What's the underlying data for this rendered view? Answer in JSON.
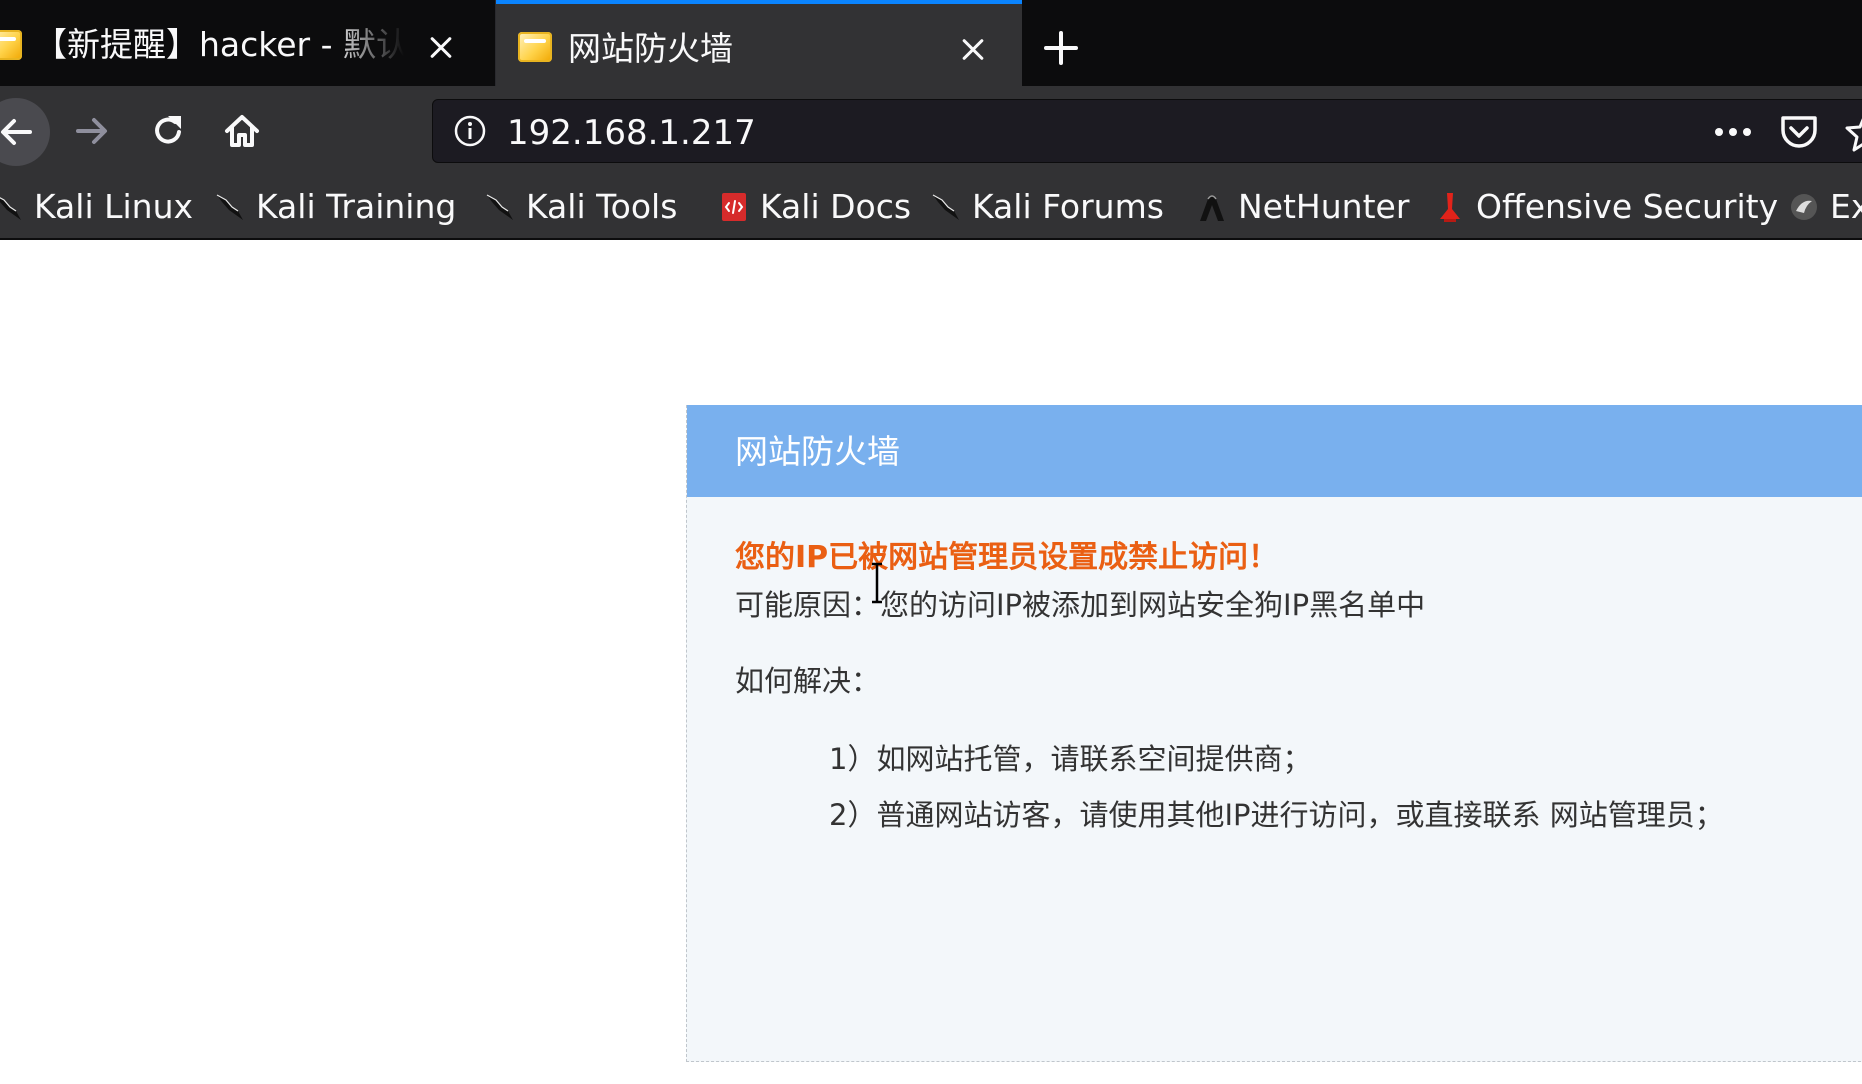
{
  "browser": {
    "tabs": [
      {
        "title": "【新提醒】hacker - 默认版块",
        "active": false
      },
      {
        "title": "网站防火墙",
        "active": true
      }
    ],
    "new_tab_icon": "plus-icon",
    "address_bar": {
      "url": "192.168.1.217",
      "site_info_icon": "info-icon"
    },
    "nav_icons": [
      "back-arrow-icon",
      "forward-arrow-icon",
      "reload-icon",
      "home-icon"
    ],
    "page_action_icons": [
      "ellipsis-icon",
      "pocket-icon",
      "star-icon"
    ],
    "bookmarks": [
      {
        "label": "Kali Linux",
        "icon": "kali-dragon-icon"
      },
      {
        "label": "Kali Training",
        "icon": "kali-dragon-icon"
      },
      {
        "label": "Kali Tools",
        "icon": "kali-dragon-icon"
      },
      {
        "label": "Kali Docs",
        "icon": "kali-docs-icon"
      },
      {
        "label": "Kali Forums",
        "icon": "kali-dragon-icon"
      },
      {
        "label": "NetHunter",
        "icon": "nethunter-icon"
      },
      {
        "label": "Offensive Security",
        "icon": "offsec-icon"
      },
      {
        "label": "Ex",
        "icon": "exploit-db-icon"
      }
    ],
    "colors": {
      "tabstrip": "#0c0c0d",
      "toolbar": "#323234",
      "active_tab_accent": "#0a84ff"
    }
  },
  "page": {
    "panel_title": "网站防火墙",
    "blocked_message": "您的IP已被网站管理员设置成禁止访问！",
    "reason": "可能原因：您的访问IP被添加到网站安全狗IP黑名单中",
    "solve_title": "如何解决：",
    "solutions": [
      "1）如网站托管，请联系空间提供商；",
      "2）普通网站访客，请使用其他IP进行访问，或直接联系 网站管理员；"
    ],
    "colors": {
      "header": "#79b0ee",
      "warning_text": "#ea5f13",
      "panel_bg": "#f3f7fa"
    }
  }
}
